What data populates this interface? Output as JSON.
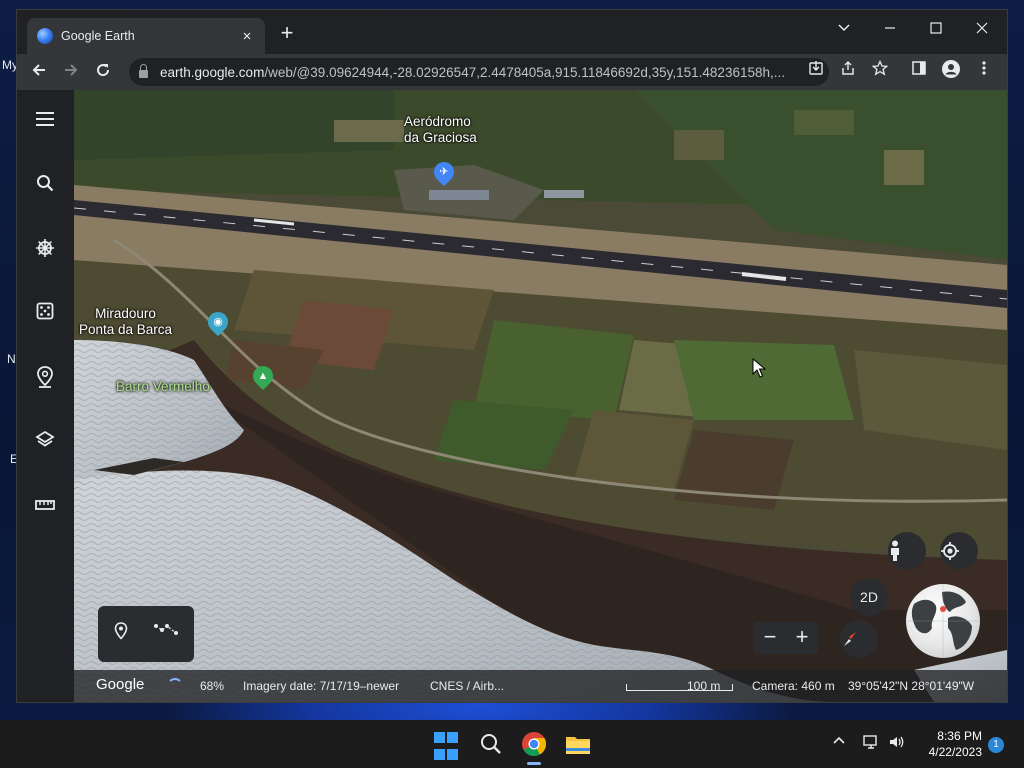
{
  "desktop": {
    "labels": [
      "My",
      "N",
      "E"
    ]
  },
  "browser": {
    "tab_title": "Google Earth",
    "tab_close": "×",
    "new_tab": "+",
    "url_host": "earth.google.com",
    "url_path": "/web/@39.09624944,-28.02926547,2.4478405a,915.11846692d,35y,151.48236158h,..."
  },
  "map": {
    "labels": {
      "airport_line1": "Aeródromo",
      "airport_line2": "da Graciosa",
      "viewpoint_line1": "Miradouro",
      "viewpoint_line2": "Ponta da Barca",
      "barro": "Barro Vermelho"
    },
    "view_mode": "2D",
    "zoom_out": "−",
    "zoom_in": "+"
  },
  "status": {
    "logo": "Google",
    "loading": "68%",
    "imagery": "Imagery date: 7/17/19–newer",
    "attribution": "CNES / Airb...",
    "scale": "100 m",
    "camera": "Camera: 460 m",
    "coords": "39°05'42\"N 28°01'49\"W"
  },
  "taskbar": {
    "time": "8:36 PM",
    "date": "4/22/2023",
    "notifications": "1"
  }
}
